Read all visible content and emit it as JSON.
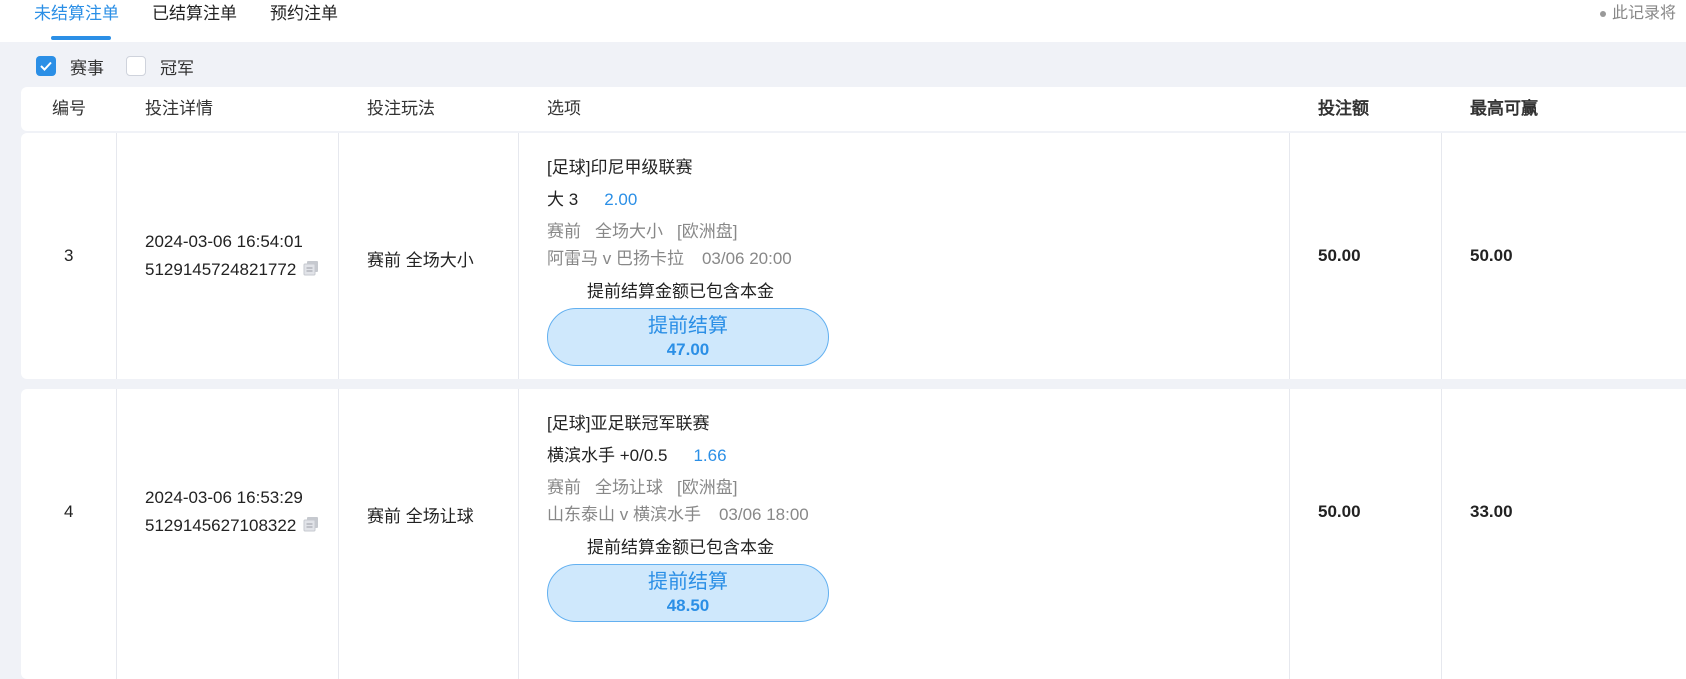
{
  "tabs": [
    {
      "label": "未结算注单",
      "active": true
    },
    {
      "label": "已结算注单",
      "active": false
    },
    {
      "label": "预约注单",
      "active": false
    }
  ],
  "notice": "此记录将",
  "filters": [
    {
      "label": "赛事",
      "checked": true
    },
    {
      "label": "冠军",
      "checked": false
    }
  ],
  "columns": {
    "id": "编号",
    "details": "投注详情",
    "play": "投注玩法",
    "option": "选项",
    "stake": "投注额",
    "max_win": "最高可赢"
  },
  "rows": [
    {
      "id": "3",
      "datetime": "2024-03-06 16:54:01",
      "order_no": "5129145724821772",
      "play": "赛前 全场大小",
      "league": "[足球]印尼甲级联赛",
      "selection": "大 3",
      "odds": "2.00",
      "market_stage": "赛前",
      "market_name": "全场大小",
      "market_type": "[欧洲盘]",
      "match": "阿雷马 v 巴扬卡拉",
      "match_time": "03/06 20:00",
      "cashout_note": "提前结算金额已包含本金",
      "cashout_label": "提前结算",
      "cashout_amount": "47.00",
      "stake": "50.00",
      "max_win": "50.00"
    },
    {
      "id": "4",
      "datetime": "2024-03-06 16:53:29",
      "order_no": "5129145627108322",
      "play": "赛前 全场让球",
      "league": "[足球]亚足联冠军联赛",
      "selection": "横滨水手 +0/0.5",
      "odds": "1.66",
      "market_stage": "赛前",
      "market_name": "全场让球",
      "market_type": "[欧洲盘]",
      "match": "山东泰山 v 横滨水手",
      "match_time": "03/06 18:00",
      "cashout_note": "提前结算金额已包含本金",
      "cashout_label": "提前结算",
      "cashout_amount": "48.50",
      "stake": "50.00",
      "max_win": "33.00"
    }
  ],
  "colors": {
    "accent": "#2b8fe6",
    "cashout_bg": "#cfe8fc",
    "page_bg": "#f0f2f7"
  }
}
